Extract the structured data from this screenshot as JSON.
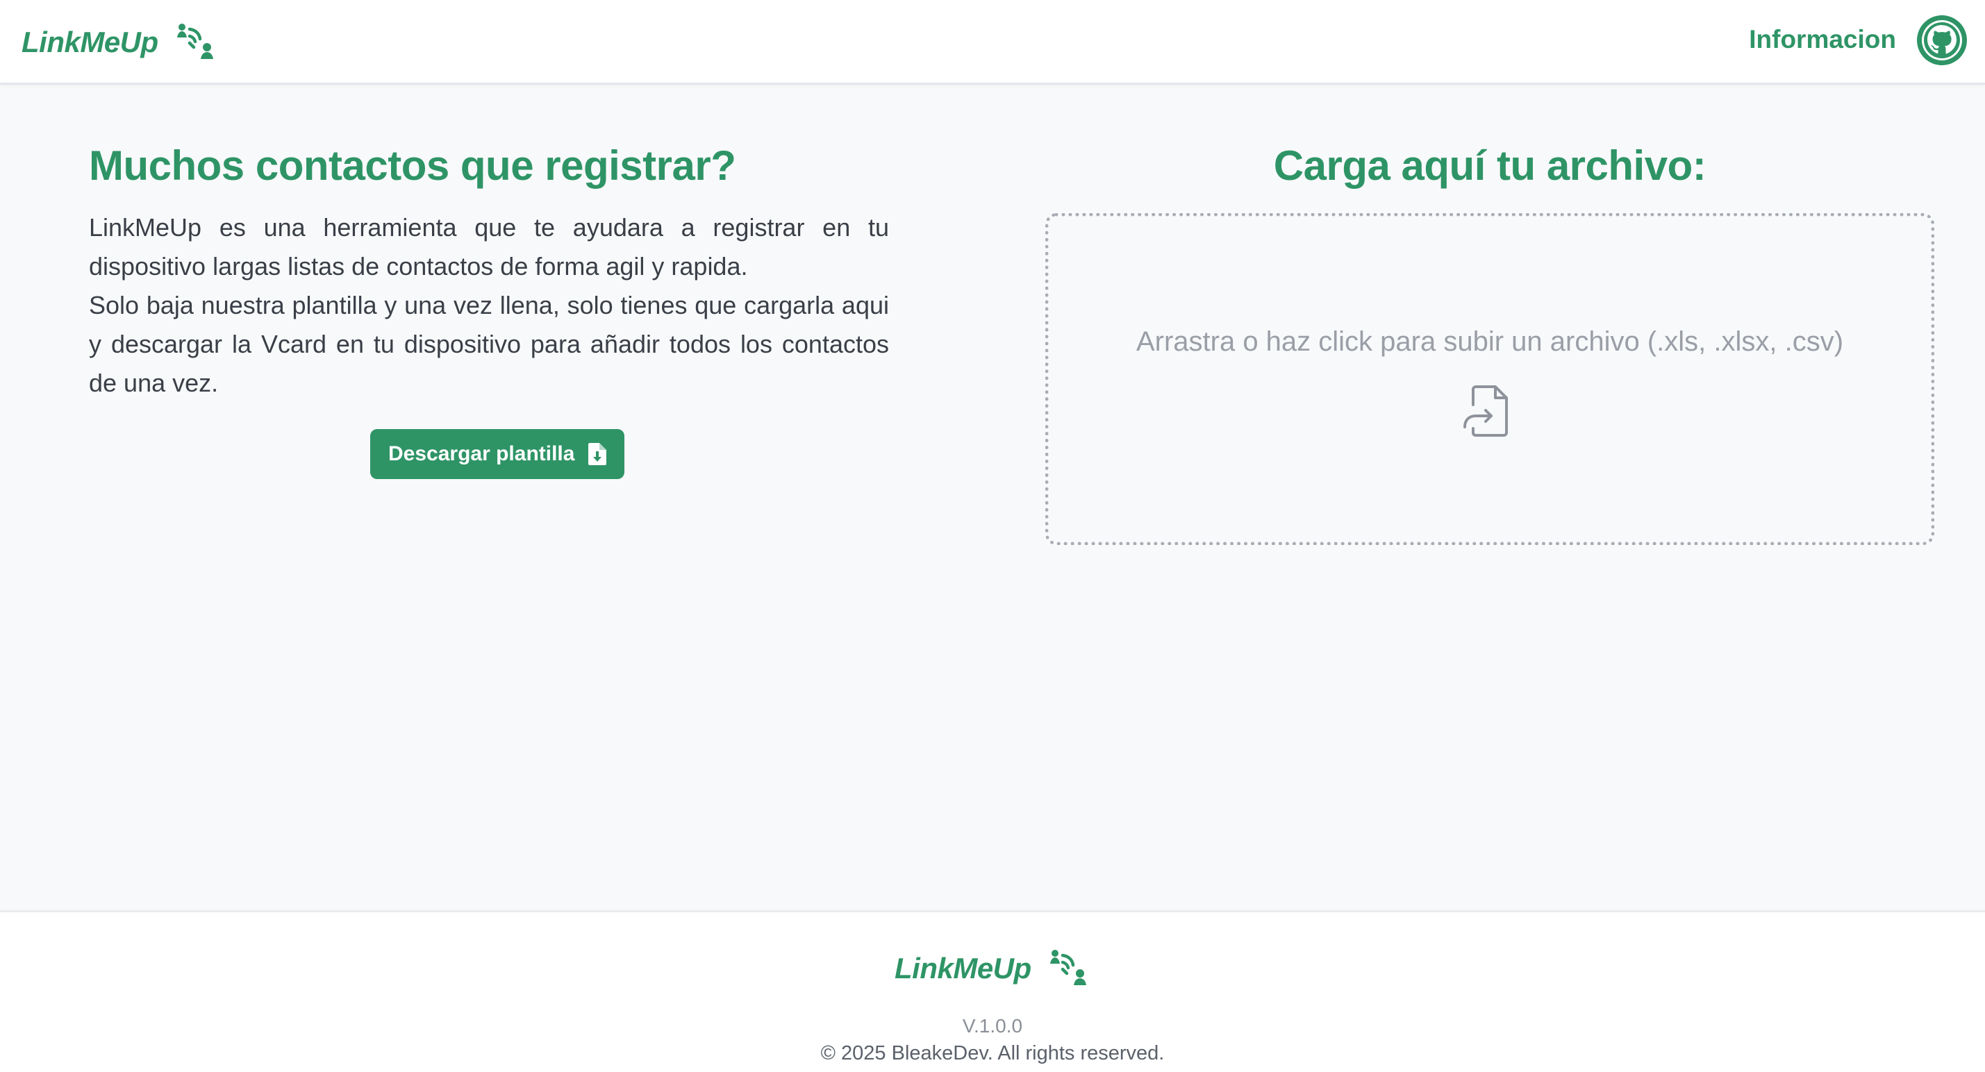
{
  "brand": {
    "name": "LinkMeUp",
    "color": "#2e9466"
  },
  "header": {
    "nav_info_label": "Informacion",
    "github_icon": "github-icon"
  },
  "intro": {
    "title": "Muchos contactos que registrar?",
    "paragraph_1": "LinkMeUp es una herramienta que te ayudara a registrar en tu dispositivo largas listas de contactos de forma agil y rapida.",
    "paragraph_2": "Solo baja nuestra plantilla y una vez llena, solo tienes que cargarla aqui y descargar la Vcard en tu dispositivo para añadir todos los contactos de una vez.",
    "download_button": {
      "label": "Descargar plantilla",
      "icon": "file-download-icon"
    }
  },
  "upload": {
    "title": "Carga aquí tu archivo:",
    "dropzone_text": "Arrastra o haz click para subir un archivo (.xls, .xlsx, .csv)",
    "dropzone_icon": "file-import-icon"
  },
  "footer": {
    "version": "V.1.0.0",
    "copyright": "© 2025 BleakeDev. All rights reserved."
  }
}
